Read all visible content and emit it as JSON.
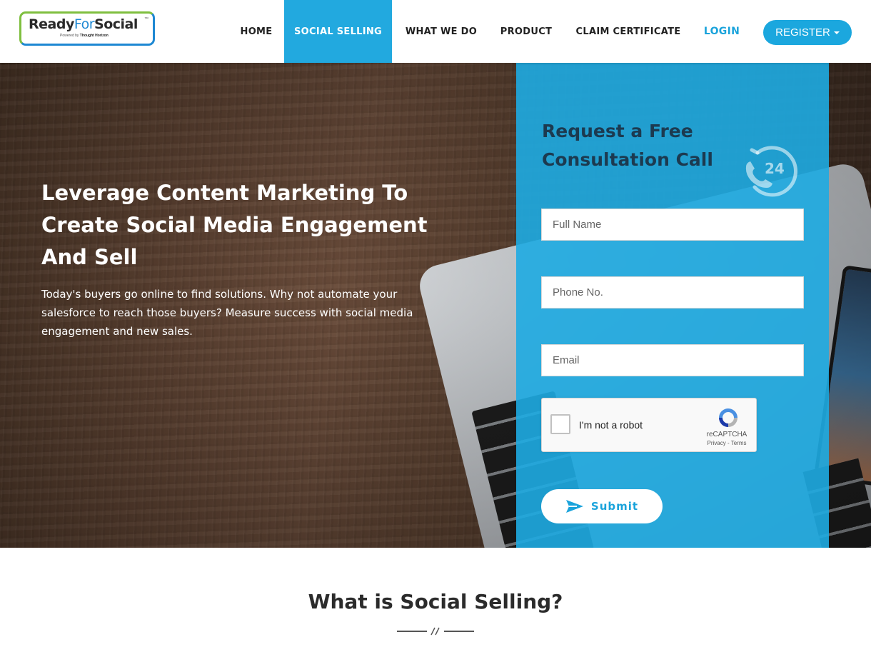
{
  "logo": {
    "main_a": "Ready",
    "main_b": "For",
    "main_c": "Social",
    "tm": "™",
    "powered": "Powered by",
    "company": "Thought Horizon"
  },
  "nav": {
    "items": [
      {
        "label": "HOME"
      },
      {
        "label": "SOCIAL SELLING",
        "active": true
      },
      {
        "label": "WHAT WE DO"
      },
      {
        "label": "PRODUCT"
      },
      {
        "label": "CLAIM CERTIFICATE"
      }
    ],
    "login": "LOGIN",
    "register": "REGISTER"
  },
  "hero": {
    "title": "Leverage Content Marketing To Create Social Media Engagement And Sell",
    "text": "Today's buyers go online to find solutions. Why not automate your salesforce to reach those buyers? Measure success with social media engagement and new sales."
  },
  "form": {
    "title": "Request a Free Consultation Call",
    "badge": "24",
    "full_name_placeholder": "Full Name",
    "phone_placeholder": "Phone No.",
    "email_placeholder": "Email",
    "captcha_label": "I'm not a robot",
    "captcha_brand": "reCAPTCHA",
    "captcha_links": "Privacy - Terms",
    "submit": "Submit"
  },
  "section": {
    "title": "What is Social Selling?"
  },
  "colors": {
    "accent": "#22a9df",
    "brand_green": "#7fbf3f",
    "brand_blue": "#1e88d3",
    "panel": "#1eabe2"
  }
}
